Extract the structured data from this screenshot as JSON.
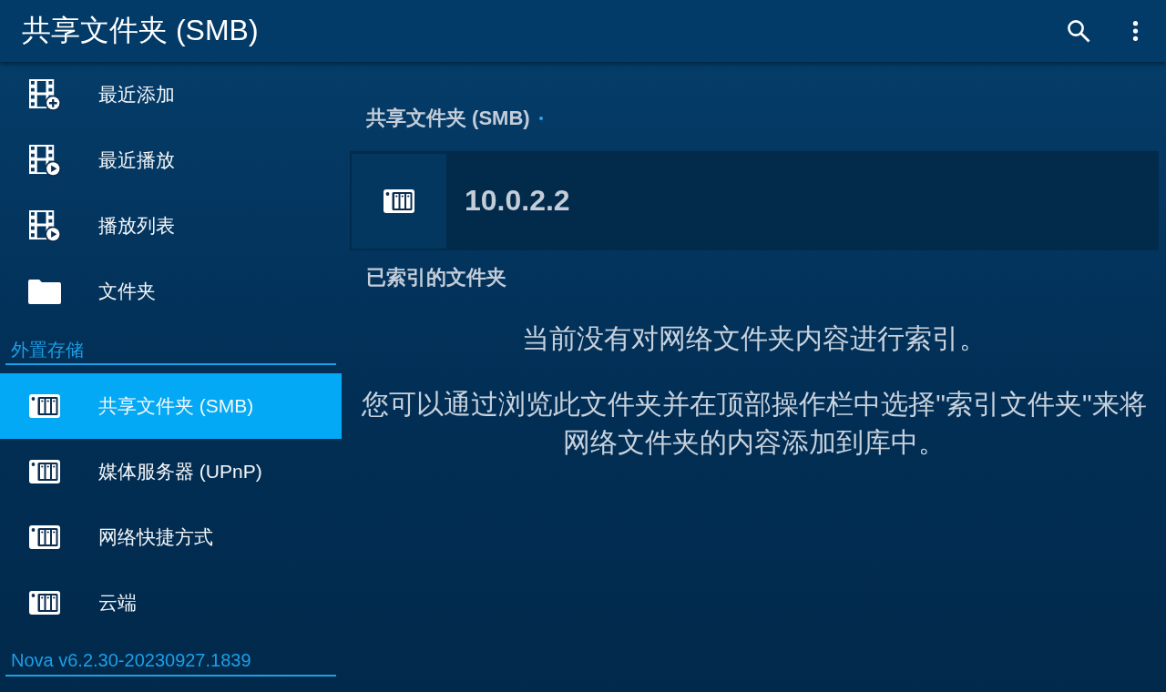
{
  "app_bar": {
    "title": "共享文件夹 (SMB)"
  },
  "sidebar": {
    "items": [
      {
        "label": "最近添加",
        "kind": "add",
        "selected": false
      },
      {
        "label": "最近播放",
        "kind": "play",
        "selected": false
      },
      {
        "label": "播放列表",
        "kind": "play",
        "selected": false
      },
      {
        "label": "文件夹",
        "kind": "folder",
        "selected": false
      }
    ],
    "sections": [
      {
        "title": "外置存储",
        "items": [
          {
            "label": "共享文件夹 (SMB)",
            "kind": "server",
            "selected": true
          },
          {
            "label": "媒体服务器 (UPnP)",
            "kind": "server",
            "selected": false
          },
          {
            "label": "网络快捷方式",
            "kind": "server",
            "selected": false
          },
          {
            "label": "云端",
            "kind": "server",
            "selected": false
          }
        ]
      }
    ],
    "version": "Nova v6.2.30-20230927.1839"
  },
  "content": {
    "title": "共享文件夹 (SMB)",
    "servers": [
      {
        "name": "10.0.2.2"
      }
    ],
    "indexed_title": "已索引的文件夹",
    "empty_message": [
      "当前没有对网络文件夹内容进行索引。",
      "您可以通过浏览此文件夹并在顶部操作栏中选择\"索引文件夹\"来将网络文件夹的内容添加到库中。"
    ]
  }
}
